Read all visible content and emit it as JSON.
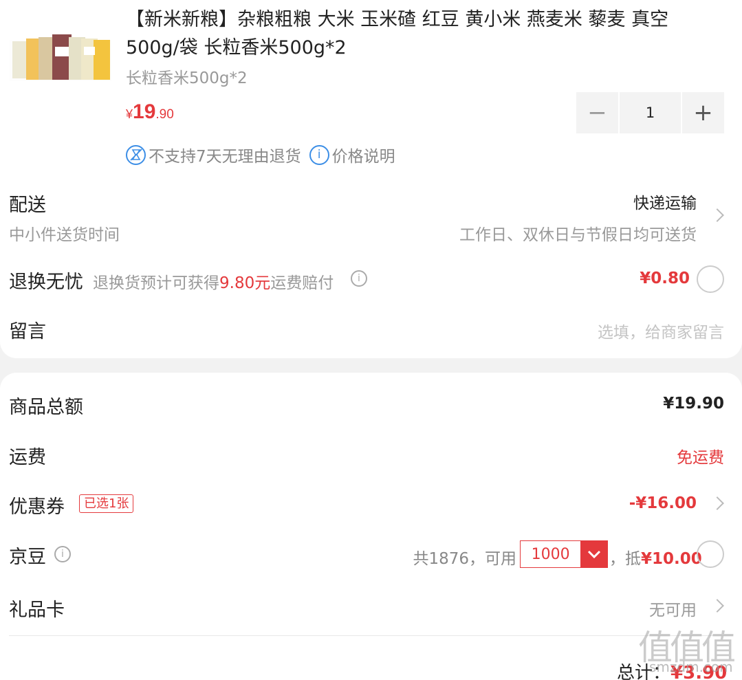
{
  "product": {
    "title": "【新米新粮】杂粮粗粮 大米 玉米碴 红豆 黄小米 燕麦米 藜麦 真空500g/袋 长粒香米500g*2",
    "spec": "长粒香米500g*2",
    "price_symbol": "¥",
    "price_int": "19",
    "price_dec": ".90",
    "quantity": "1",
    "minus": "−",
    "plus": "+",
    "tag_no_return": "不支持7天无理由退货",
    "tag_price_note": "价格说明"
  },
  "delivery": {
    "label": "配送",
    "sub": "中小件送货时间",
    "method": "快递运输",
    "time": "工作日、双休日与节假日均可送货"
  },
  "return_worry": {
    "label": "退换无忧",
    "desc_pre": "退换货预计可获得",
    "desc_amount": "9.80元",
    "desc_post": "运费赔付",
    "price": "¥0.80"
  },
  "message": {
    "label": "留言",
    "placeholder": "选填，给商家留言"
  },
  "summary": {
    "goods_total_label": "商品总额",
    "goods_total": "¥19.90",
    "shipping_label": "运费",
    "shipping": "免运费",
    "coupon_label": "优惠券",
    "coupon_badge": "已选1张",
    "coupon_amount": "-¥16.00",
    "bean_label": "京豆",
    "bean_total": "共1876，可用",
    "bean_value": "1000",
    "bean_deduct_pre": "，抵",
    "bean_deduct": "¥10.00",
    "gift_label": "礼品卡",
    "gift_value": "无可用",
    "total_label": "总计：",
    "total_amount": "¥3.90"
  },
  "watermark": {
    "text": "值值值",
    "sub": "smzdm.com"
  },
  "colors": {
    "accent": "#e4393c",
    "info_blue": "#3c8ee6"
  }
}
